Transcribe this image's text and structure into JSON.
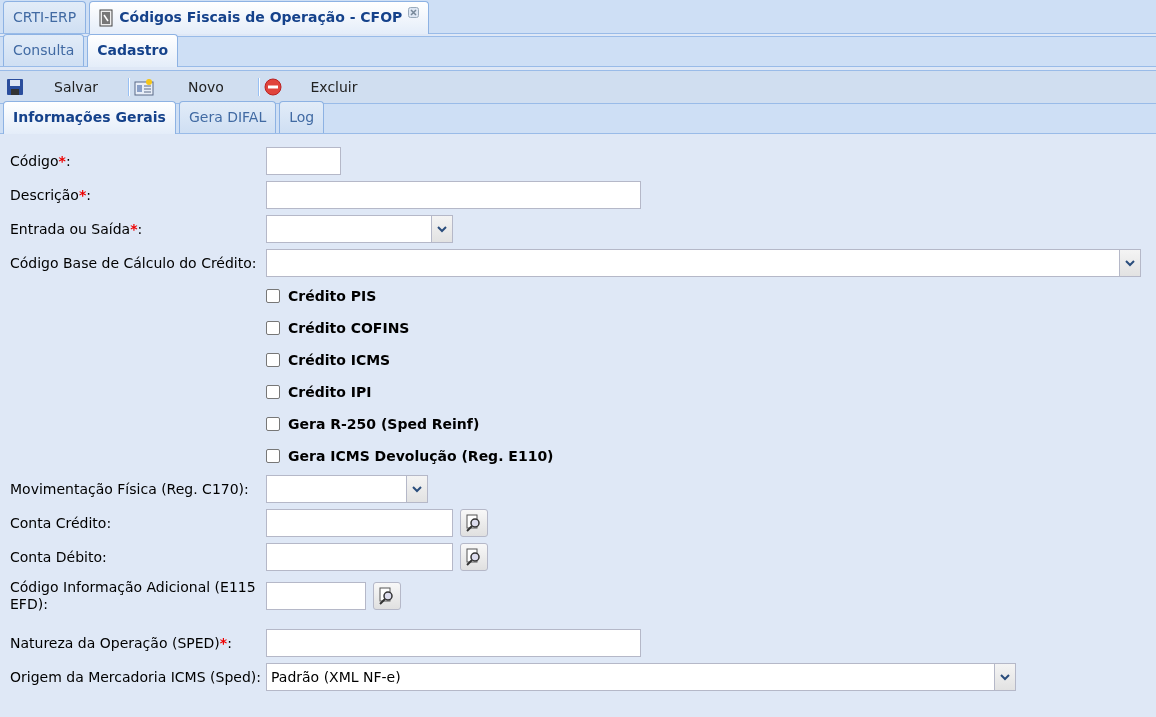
{
  "app_tabs": [
    {
      "label": "CRTI-ERP",
      "selected": false,
      "closable": false,
      "icon": false
    },
    {
      "label": "Códigos Fiscais de Operação - CFOP",
      "selected": true,
      "closable": true,
      "icon": true
    }
  ],
  "mode_tabs": [
    {
      "label": "Consulta",
      "selected": false
    },
    {
      "label": "Cadastro",
      "selected": true
    }
  ],
  "toolbar": [
    {
      "label": "Salvar",
      "kind": "save"
    },
    {
      "label": "Novo",
      "kind": "new"
    },
    {
      "label": "Excluir",
      "kind": "delete"
    }
  ],
  "section_tabs": [
    {
      "label": "Informações Gerais",
      "selected": true
    },
    {
      "label": "Gera DIFAL",
      "selected": false
    },
    {
      "label": "Log",
      "selected": false
    }
  ],
  "fields": [
    {
      "kind": "text",
      "label": "Código",
      "required_mark": "*",
      "label_end": ":"
    },
    {
      "kind": "text",
      "label": "Descrição",
      "required_mark": "*",
      "label_end": ":"
    },
    {
      "kind": "combo",
      "label": "Entrada ou Saída",
      "required_mark": "*",
      "label_end": ":"
    },
    {
      "kind": "combo",
      "label": "Código Base de Cálculo do Crédito:"
    },
    {
      "kind": "checkbox",
      "label": "Crédito PIS",
      "checked": false
    },
    {
      "kind": "checkbox",
      "label": "Crédito COFINS",
      "checked": false
    },
    {
      "kind": "checkbox",
      "label": "Crédito ICMS",
      "checked": false
    },
    {
      "kind": "checkbox",
      "label": "Crédito IPI",
      "checked": false
    },
    {
      "kind": "checkbox",
      "label": "Gera R-250 (Sped Reinf)",
      "checked": false
    },
    {
      "kind": "checkbox",
      "label": "Gera ICMS Devolução (Reg. E110)",
      "checked": false
    },
    {
      "kind": "combo",
      "label": "Movimentação Física (Reg. C170):"
    },
    {
      "kind": "lookup",
      "label": "Conta Crédito:"
    },
    {
      "kind": "lookup",
      "label": "Conta Débito:"
    },
    {
      "kind": "lookup",
      "label": "Código Informação Adicional (E115 EFD):"
    },
    {
      "kind": "text",
      "label": "Natureza da Operação (SPED)",
      "required_mark": "*",
      "label_end": ":"
    },
    {
      "kind": "combo",
      "label": "Origem da Mercadoria ICMS (Sped):",
      "value": "Padrão (XML NF-e)"
    }
  ]
}
